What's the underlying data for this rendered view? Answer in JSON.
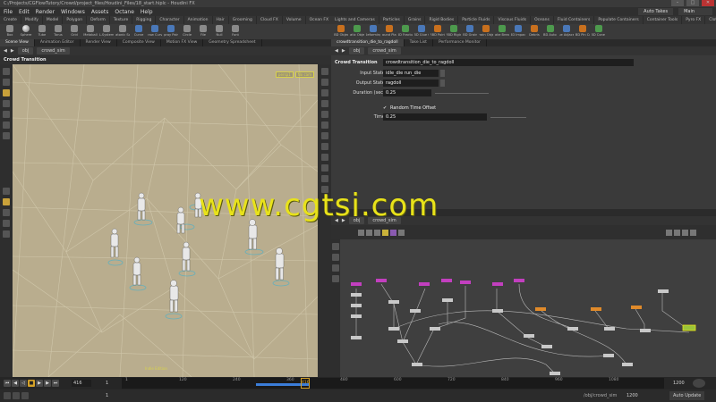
{
  "window": {
    "title": "C:/Projects/CGFlowTutory/Crowd/project_files/Houdini_Files/18_start.hiplc - Houdini FX"
  },
  "menu": {
    "items": [
      "File",
      "Edit",
      "Render",
      "Windows",
      "Assets",
      "Octane",
      "Help"
    ],
    "auto_takes": "Auto Takes",
    "desktop": "Main"
  },
  "shelf_tabs_left": [
    "Create",
    "Modify",
    "Model",
    "Polygon",
    "Deform",
    "Texture",
    "Rigging",
    "Character",
    "Animation",
    "Hair",
    "Grooming",
    "Cloud FX",
    "Volume",
    "Ocean FX",
    "Octane"
  ],
  "shelf_tabs_right": [
    "Lights and Cameras",
    "Particles",
    "Grains",
    "Rigid Bodies",
    "Particle Fluids",
    "Viscous Fluids",
    "Oceans",
    "Fluid Containers",
    "Populate Containers",
    "Container Tools",
    "Pyro FX",
    "Cloth",
    "Solid",
    "Wires",
    "Crowds",
    "Drive Simulation"
  ],
  "shelf_tools_left": [
    {
      "label": "Box",
      "icon": "box-icon"
    },
    {
      "label": "Sphere",
      "icon": "sphere-icon"
    },
    {
      "label": "Tube",
      "icon": "tube-icon"
    },
    {
      "label": "Torus",
      "icon": "torus-icon"
    },
    {
      "label": "Grid",
      "icon": "grid-icon"
    },
    {
      "label": "Metaball",
      "icon": "metaball-icon"
    },
    {
      "label": "L-System",
      "icon": "lsystem-icon"
    },
    {
      "label": "Platonic Sol.",
      "icon": "platonic-icon"
    },
    {
      "label": "Curve",
      "icon": "curve-icon"
    },
    {
      "label": "Draw Curve",
      "icon": "draw-curve-icon"
    },
    {
      "label": "Spray Paint",
      "icon": "spray-paint-icon"
    },
    {
      "label": "Circle",
      "icon": "circle-icon"
    },
    {
      "label": "File",
      "icon": "file-icon"
    },
    {
      "label": "Null",
      "icon": "null-icon"
    },
    {
      "label": "Font",
      "icon": "font-icon"
    }
  ],
  "shelf_tools_right": [
    {
      "label": "RBD Object",
      "icon": "rbd-object-icon"
    },
    {
      "label": "Static Object",
      "icon": "static-object-icon"
    },
    {
      "label": "Deforming",
      "icon": "deforming-icon"
    },
    {
      "label": "Ground Plane",
      "icon": "ground-plane-icon"
    },
    {
      "label": "RBD Fracture",
      "icon": "rbd-fracture-icon"
    },
    {
      "label": "RBD Glue O.",
      "icon": "rbd-glue-icon"
    },
    {
      "label": "RBD Point",
      "icon": "rbd-point-icon"
    },
    {
      "label": "RBD Rigid",
      "icon": "rbd-rigid-icon"
    },
    {
      "label": "RBD Grains",
      "icon": "rbd-grains-icon"
    },
    {
      "label": "Terrain Object",
      "icon": "terrain-icon"
    },
    {
      "label": "Make Break.",
      "icon": "make-breakable-icon"
    },
    {
      "label": "RBD Impacts",
      "icon": "rbd-impacts-icon"
    },
    {
      "label": "Debris",
      "icon": "debris-icon"
    },
    {
      "label": "RBD Auto F.",
      "icon": "rbd-auto-icon"
    },
    {
      "label": "Glue Adjacent",
      "icon": "glue-adjacent-icon"
    },
    {
      "label": "RBD Pin Co.",
      "icon": "rbd-pin-icon"
    },
    {
      "label": "RBD Cone T.",
      "icon": "rbd-cone-icon"
    }
  ],
  "pane_tabs_left": [
    "Scene View",
    "Animation Editor",
    "Render View",
    "Composite View",
    "Motion FX View",
    "Geometry Spreadsheet"
  ],
  "pane_tabs_right": [
    "crowdtransition_die_to_ragdoll",
    "Take List",
    "Performance Monitor"
  ],
  "viewport": {
    "path_obj": "obj",
    "path_node": "crowd_sim",
    "title": "Crowd Transition",
    "camera_label": "persp1",
    "cam_label": "No cam",
    "indie_label": "Indie Edition"
  },
  "params": {
    "path_obj": "obj",
    "path_node": "crowd_sim",
    "node_type": "Crowd Transition",
    "node_name": "crowdtransition_die_to_ragdoll",
    "input_state_label": "Input State",
    "input_state_value": "idle_die run_die",
    "output_state_label": "Output State",
    "output_state_value": "ragdoll",
    "duration_label": "Duration (sec)",
    "duration_value": "0.25",
    "random_offset_label": "Random Time Offset",
    "time_label": "Time",
    "time_value": "0.25"
  },
  "network": {
    "path_obj": "obj",
    "path_node": "crowd_sim"
  },
  "watermark": "www.cgtsj.com",
  "timeline": {
    "current_frame": "416",
    "start_frame": "1",
    "end_frame": "1200",
    "end_frame_2": "1200",
    "marker": "416",
    "ticks": [
      "1",
      "120",
      "240",
      "360",
      "480",
      "600",
      "720",
      "840",
      "960",
      "1080"
    ]
  },
  "status": {
    "path": "/obj/crowd_sim",
    "auto_update": "Auto Update"
  }
}
